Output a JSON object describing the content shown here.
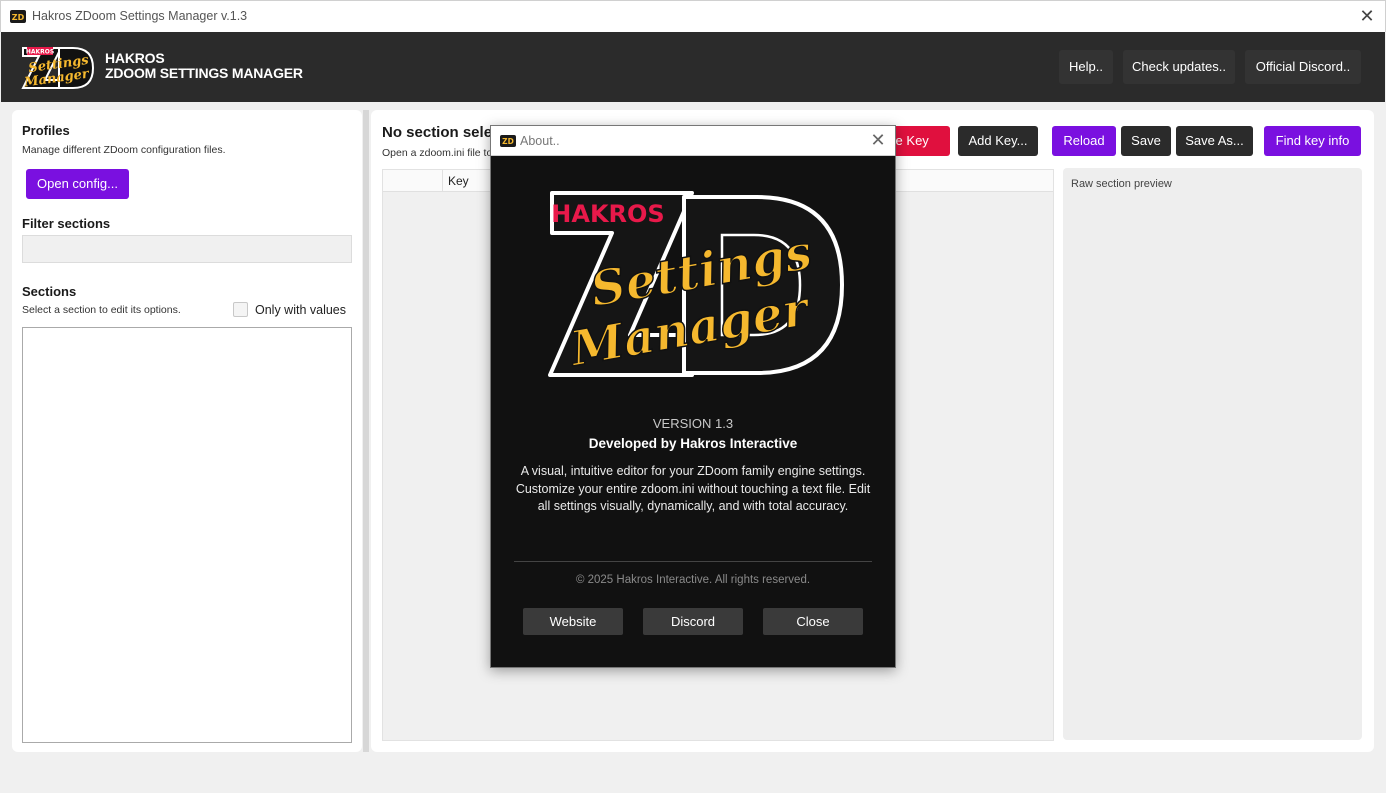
{
  "window": {
    "title": "Hakros ZDoom Settings Manager v.1.3",
    "close_glyph": "✕"
  },
  "header": {
    "brand_line1": "HAKROS",
    "brand_line2": "ZDOOM SETTINGS MANAGER",
    "logo_badge": "HAKROS",
    "logo_script1": "Settings",
    "logo_script2": "Manager",
    "help_label": "Help..",
    "updates_label": "Check updates..",
    "discord_label": "Official Discord.."
  },
  "left": {
    "profiles_title": "Profiles",
    "profiles_sub": "Manage different ZDoom configuration files.",
    "open_config_label": "Open config...",
    "filter_title": "Filter sections",
    "filter_value": "",
    "sections_title": "Sections",
    "sections_sub": "Select a section to edit its options.",
    "only_values_label": "Only with values"
  },
  "main": {
    "title": "No section selected",
    "subtitle": "Open a zdoom.ini file to begin.",
    "delete_key_label": "Delete Key",
    "add_key_label": "Add Key...",
    "reload_label": "Reload",
    "save_label": "Save",
    "save_as_label": "Save As...",
    "find_key_label": "Find key info",
    "grid_key_header": "Key",
    "preview_label": "Raw section preview"
  },
  "about": {
    "title": "About..",
    "close_glyph": "✕",
    "logo_badge": "HAKROS",
    "logo_script1": "Settings",
    "logo_script2": "Manager",
    "version": "VERSION 1.3",
    "developer": "Developed by Hakros Interactive",
    "description": "A visual, intuitive editor for your ZDoom family engine settings. Customize your entire zdoom.ini without touching a text file. Edit all settings visually, dynamically, and with total accuracy.",
    "copyright": "© 2025 Hakros Interactive. All rights reserved.",
    "website_label": "Website",
    "discord_label": "Discord",
    "close_label": "Close"
  },
  "colors": {
    "accent_purple": "#7a10e0",
    "danger_red": "#e0103e",
    "header_dark": "#2b2b2b",
    "logo_yellow": "#f5b82e",
    "logo_badge_red": "#e8194a"
  }
}
